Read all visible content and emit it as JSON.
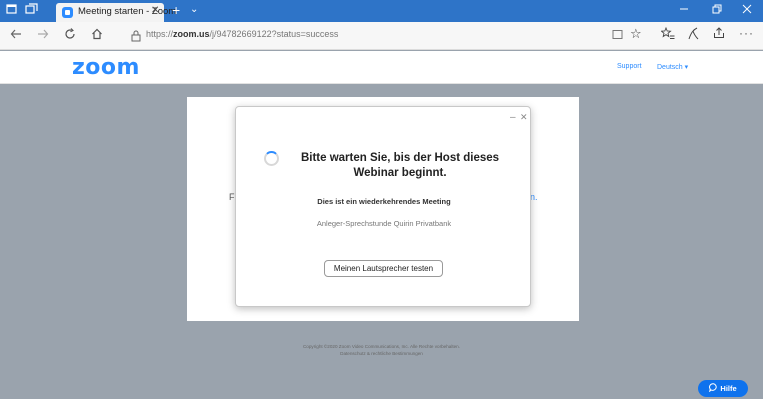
{
  "browser": {
    "tab": {
      "title": "Meeting starten - Zoom",
      "close": "✕"
    },
    "new_tab": "+",
    "tab_menu": "⌄",
    "address": {
      "url_prefix": "https://",
      "url_domain": "zoom.us",
      "url_path": "/j/94782669122?status=success"
    }
  },
  "zoom": {
    "logo": "zoom",
    "header_links": {
      "support": "Support",
      "language": "Deutsch ▾"
    }
  },
  "background": {
    "left_fragment": "F",
    "right_fragment": "n."
  },
  "dialog": {
    "minimize": "–",
    "close": "✕",
    "title": "Bitte warten Sie, bis der Host dieses Webinar beginnt.",
    "subtitle": "Dies ist ein wiederkehrendes Meeting",
    "meeting_name": "Anleger-Sprechstunde Quirin Privatbank",
    "speaker_button": "Meinen Lautsprecher testen"
  },
  "footer": {
    "copyright": "Copyright ©2020 Zoom Video Communications, Inc. Alle Rechte vorbehalten.",
    "privacy": "Datenschutz & rechtliche Bestimmungen"
  },
  "help": {
    "label": "Hilfe"
  },
  "icons": [
    "tab-actions-icon",
    "tab-sets-icon",
    "back-icon",
    "forward-icon",
    "refresh-icon",
    "home-icon",
    "lock-icon",
    "reading-view-icon",
    "favorite-icon",
    "favorites-bar-icon",
    "collections-icon",
    "share-icon",
    "more-icon",
    "spinner-icon",
    "chat-icon"
  ],
  "colors": {
    "titlebar": "#2e74c8",
    "zoom_blue": "#2d8cff",
    "help_button": "#0e72ed",
    "page_bg": "#9aa3ad"
  }
}
